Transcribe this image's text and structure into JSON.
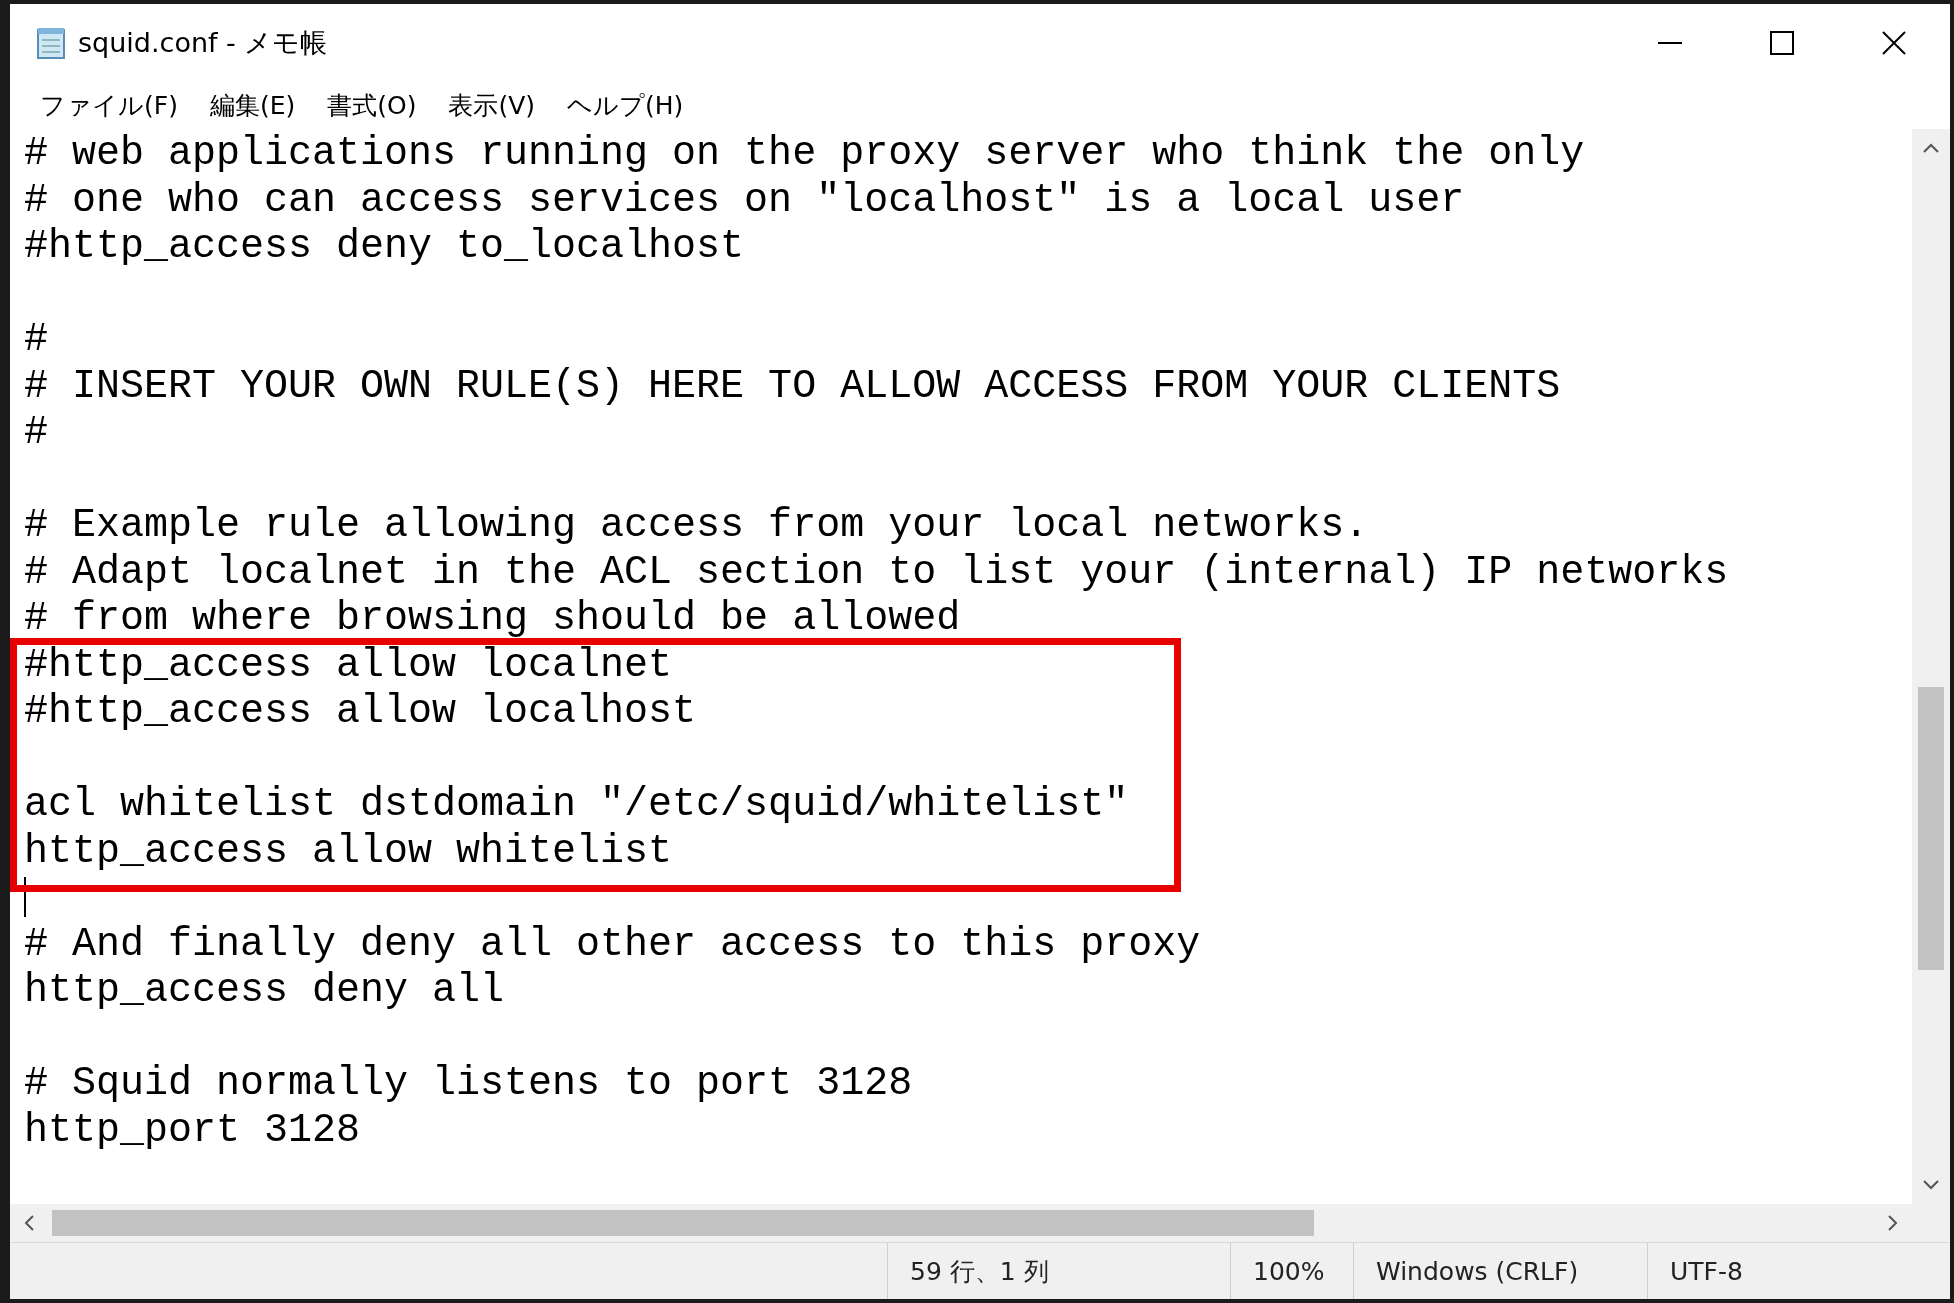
{
  "window": {
    "title": "squid.conf - メモ帳"
  },
  "menu": [
    "ファイル(F)",
    "編集(E)",
    "書式(O)",
    "表示(V)",
    "ヘルプ(H)"
  ],
  "editor": {
    "lines": [
      {
        "kind": "text",
        "text": "# web applications running on the proxy server who think the only"
      },
      {
        "kind": "text",
        "text": "# one who can access services on \"localhost\" is a local user"
      },
      {
        "kind": "text",
        "text": "#http_access deny to_localhost"
      },
      {
        "kind": "blank"
      },
      {
        "kind": "text",
        "text": "#"
      },
      {
        "kind": "text",
        "text": "# INSERT YOUR OWN RULE(S) HERE TO ALLOW ACCESS FROM YOUR CLIENTS"
      },
      {
        "kind": "text",
        "text": "#"
      },
      {
        "kind": "blank"
      },
      {
        "kind": "text",
        "text": "# Example rule allowing access from your local networks."
      },
      {
        "kind": "text",
        "text": "# Adapt localnet in the ACL section to list your (internal) IP networks"
      },
      {
        "kind": "text",
        "text": "# from where browsing should be allowed"
      },
      {
        "kind": "text",
        "text": "#http_access allow localnet"
      },
      {
        "kind": "text",
        "text": "#http_access allow localhost"
      },
      {
        "kind": "blank"
      },
      {
        "kind": "text",
        "text": "acl whitelist dstdomain \"/etc/squid/whitelist\""
      },
      {
        "kind": "text",
        "text": "http_access allow whitelist"
      },
      {
        "kind": "caret"
      },
      {
        "kind": "text",
        "text": "# And finally deny all other access to this proxy"
      },
      {
        "kind": "text",
        "text": "http_access deny all"
      },
      {
        "kind": "blank"
      },
      {
        "kind": "text",
        "text": "# Squid normally listens to port 3128"
      },
      {
        "kind": "text",
        "text": "http_port 3128"
      }
    ]
  },
  "status_bar": {
    "position": "59 行、1 列",
    "zoom": "100%",
    "line_ending": "Windows (CRLF)",
    "encoding": "UTF-8"
  }
}
